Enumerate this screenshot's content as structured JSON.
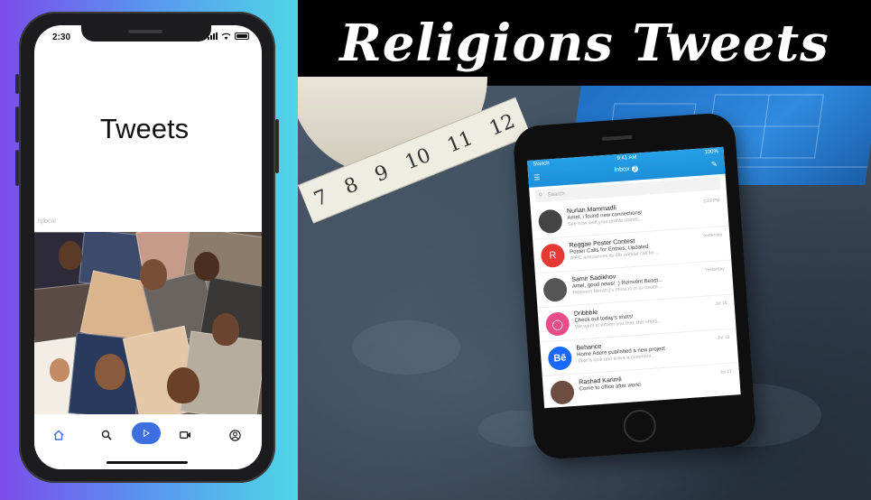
{
  "phone": {
    "status_time": "2:30",
    "title": "Tweets",
    "caption": "hjlbcnl",
    "nav": [
      {
        "icon": "home-icon",
        "active": true
      },
      {
        "icon": "search-icon",
        "active": false
      },
      {
        "icon": "play-icon",
        "active": true
      },
      {
        "icon": "video-icon",
        "active": false
      },
      {
        "icon": "account-icon",
        "active": false
      }
    ]
  },
  "banner": {
    "title": "Religions Tweets"
  },
  "mockup": {
    "status_left": "Sketch",
    "status_center": "9:41 AM",
    "status_right": "100%",
    "header_title": "Inbox",
    "header_badge": "3",
    "search_placeholder": "Search",
    "emails": [
      {
        "name": "Nurlan Mammadli",
        "line1": "Amel, i found new connections!",
        "line2": "See how well your profile stands...",
        "time": "3:23 PM",
        "avatar_color": "#444"
      },
      {
        "name": "Reggae Poster Contest",
        "line1": "Poster Calls for Entries, Updated",
        "line2": "IRPC announces its 4th annual call for...",
        "time": "Yesterday",
        "avatar_color": "#e53935",
        "avatar_letter": "R"
      },
      {
        "name": "Samir Sadikhov",
        "line1": "Amel, good news! :) Reinvent Beast...",
        "line2": "Reinvent Ministry's mission is to create...",
        "time": "Yesterday",
        "avatar_color": "#555"
      },
      {
        "name": "Dribbble",
        "line1": "Check out today's shots!",
        "line2": "We want to inform you that, this shots...",
        "time": "Jul 18",
        "avatar_color": "#ea4c89"
      },
      {
        "name": "Behance",
        "line1": "Home Adore published a new project",
        "line2": "Take a look and leave a comment...",
        "time": "Jul 18",
        "avatar_color": "#1769ff",
        "avatar_letter": "Bē"
      },
      {
        "name": "Rashad Karimli",
        "line1": "Come to office after work!",
        "line2": "",
        "time": "Jul 17",
        "avatar_color": "#6d4c41"
      }
    ]
  },
  "tape": {
    "numbers": [
      "7",
      "8",
      "9",
      "10",
      "11",
      "12"
    ]
  },
  "colors": {
    "accent": "#3d6fe0",
    "mail_header": "#1d8fd8"
  }
}
